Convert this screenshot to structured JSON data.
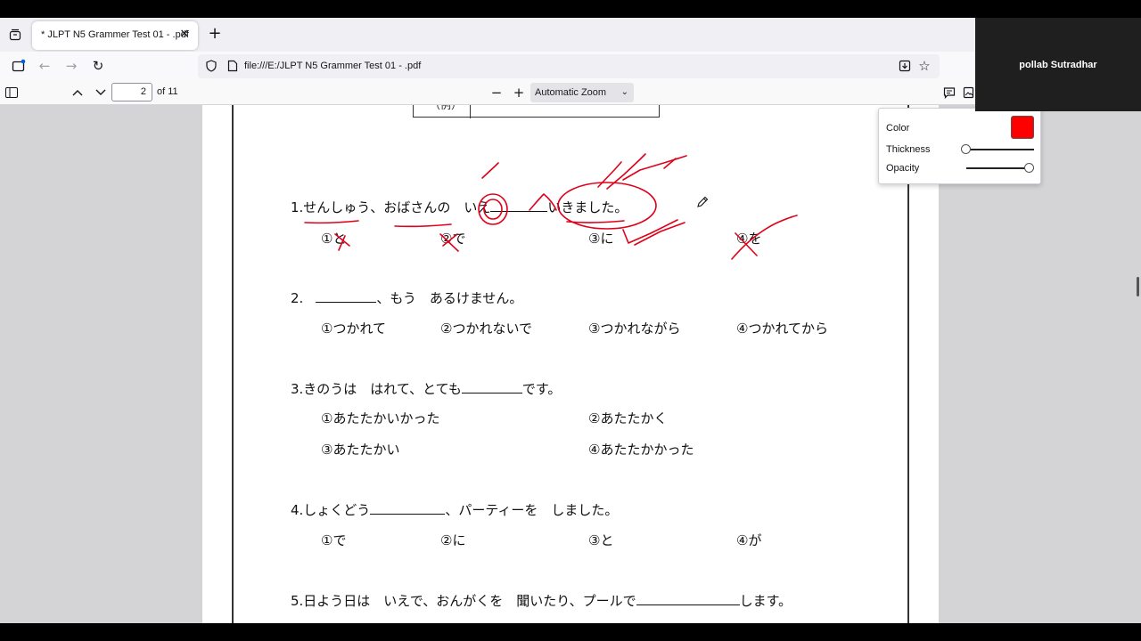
{
  "browser": {
    "tab_title": "* JLPT N5 Grammer Test 01 - .pdf",
    "tab_close": "✕",
    "new_tab": "+",
    "url": "file:///E:/JLPT N5 Grammer Test 01 - .pdf"
  },
  "pdf_toolbar": {
    "page_number": "2",
    "page_count": "of 11",
    "zoom_minus": "−",
    "zoom_plus": "+",
    "zoom_value": "Automatic Zoom"
  },
  "document": {
    "example_label": "（例）",
    "questions": [
      {
        "stem": "1.せんしゅう、おばさんの　いえ",
        "stem_tail": "いきました。",
        "options": [
          "①と",
          "②で",
          "③に",
          "④を"
        ]
      },
      {
        "stem_num": "2.",
        "stem_tail": "、もう　あるけません。",
        "options": [
          "①つかれて",
          "②つかれないで",
          "③つかれながら",
          "④つかれてから"
        ]
      },
      {
        "stem": "3.きのうは　はれて、とても",
        "stem_tail": "です。",
        "options": [
          "①あたたかいかった",
          "②あたたかく",
          "③あたたかい",
          "④あたたかかった"
        ]
      },
      {
        "stem": "4.しょくどう",
        "stem_tail": "、パーティーを　しました。",
        "options": [
          "①で",
          "②に",
          "③と",
          "④が"
        ]
      },
      {
        "stem": "5.日よう日は　いえで、おんがくを　聞いたり、プールで",
        "stem_tail": "します。"
      }
    ]
  },
  "ink_editor": {
    "color_label": "Color",
    "thickness_label": "Thickness",
    "opacity_label": "Opacity",
    "color_value": "#ff0000",
    "thickness": 0.0,
    "opacity": 1.0
  },
  "presenter": {
    "name": "pollab Sutradhar"
  },
  "colors": {
    "annotation": "#e0001a"
  }
}
